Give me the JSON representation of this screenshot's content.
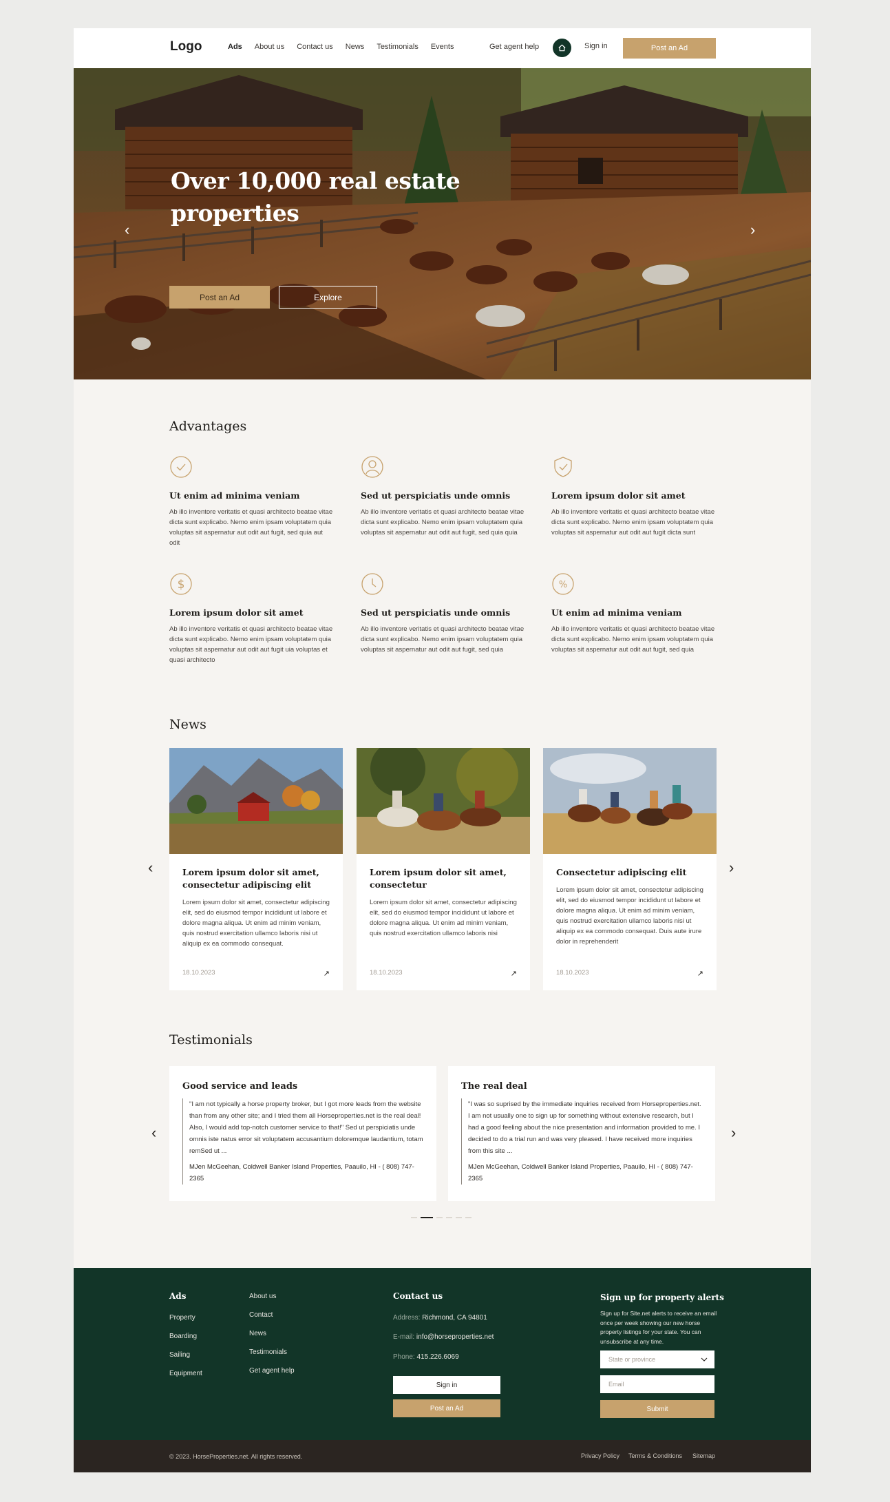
{
  "header": {
    "logo": "Logo",
    "nav": [
      "Ads",
      "About us",
      "Contact us",
      "News",
      "Testimonials",
      "Events"
    ],
    "agent_help": "Get agent help",
    "sign_in": "Sign in",
    "post_ad": "Post an Ad"
  },
  "hero": {
    "title": "Over 10,000  real estate properties",
    "post_ad": "Post an Ad",
    "explore": "Explore"
  },
  "advantages": {
    "heading": "Advantages",
    "items": [
      {
        "icon": "check-circle-icon",
        "title": "Ut enim ad minima veniam",
        "text": "Ab illo inventore veritatis et quasi architecto beatae vitae dicta sunt explicabo. Nemo enim ipsam voluptatem quia voluptas sit aspernatur aut odit aut fugit, sed quia  aut odit"
      },
      {
        "icon": "user-circle-icon",
        "title": "Sed ut perspiciatis unde omnis",
        "text": "Ab illo inventore veritatis et quasi architecto beatae vitae dicta sunt explicabo. Nemo enim ipsam voluptatem quia voluptas sit aspernatur aut odit aut fugit, sed quia quia"
      },
      {
        "icon": "shield-check-icon",
        "title": "Lorem ipsum dolor sit amet",
        "text": "Ab illo inventore veritatis et quasi architecto beatae vitae dicta sunt explicabo. Nemo enim ipsam voluptatem quia voluptas sit aspernatur aut odit aut fugit dicta sunt"
      },
      {
        "icon": "dollar-circle-icon",
        "title": "Lorem ipsum dolor sit amet",
        "text": "Ab illo inventore veritatis et quasi architecto beatae vitae dicta sunt explicabo. Nemo enim ipsam voluptatem quia voluptas sit aspernatur aut odit aut fugit uia voluptas et quasi architecto"
      },
      {
        "icon": "clock-circle-icon",
        "title": "Sed ut perspiciatis unde omnis",
        "text": "Ab illo inventore veritatis et quasi architecto beatae vitae dicta sunt explicabo. Nemo enim ipsam voluptatem quia voluptas sit aspernatur aut odit aut fugit, sed quia"
      },
      {
        "icon": "percent-circle-icon",
        "title": "Ut enim ad minima veniam",
        "text": "Ab illo inventore veritatis et quasi architecto beatae vitae dicta sunt explicabo. Nemo enim ipsam voluptatem quia voluptas sit aspernatur aut odit aut fugit, sed quia"
      }
    ]
  },
  "news": {
    "heading": "News",
    "items": [
      {
        "title": "Lorem ipsum dolor sit amet, consectetur adipiscing elit",
        "text": "Lorem ipsum dolor sit amet, consectetur adipiscing elit, sed do eiusmod tempor incididunt ut labore et dolore magna aliqua. Ut enim ad minim veniam, quis nostrud exercitation ullamco laboris nisi ut aliquip ex ea commodo consequat.",
        "date": "18.10.2023"
      },
      {
        "title": "Lorem ipsum dolor sit amet, consectetur",
        "text": "Lorem ipsum dolor sit amet, consectetur adipiscing elit, sed do eiusmod tempor incididunt ut labore et dolore magna aliqua. Ut enim ad minim veniam, quis nostrud exercitation ullamco laboris nisi",
        "date": "18.10.2023"
      },
      {
        "title": "Consectetur adipiscing elit",
        "text": "Lorem ipsum dolor sit amet, consectetur adipiscing elit, sed do eiusmod tempor incididunt ut labore et dolore magna aliqua. Ut enim ad minim veniam, quis nostrud exercitation ullamco laboris nisi ut aliquip ex ea commodo consequat. Duis aute irure dolor in reprehenderit",
        "date": "18.10.2023"
      }
    ]
  },
  "testimonials": {
    "heading": "Testimonials",
    "items": [
      {
        "title": "Good service and leads",
        "quote": "\"I am not typically a horse property broker, but I got more leads from the website than from any other site; and I tried them all Horseproperties.net is the real deal! Also, I would add top-notch customer service to that!\" Sed ut perspiciatis unde omnis iste natus error sit voluptatem accusantium doloremque laudantium, totam remSed ut ...",
        "author": "MJen McGeehan, Coldwell Banker Island Properties, Paauilo, HI - ( 808) 747-2365"
      },
      {
        "title": "The real deal",
        "quote": "\"I was so suprised by the immediate inquiries received from Horseproperties.net. I am not usually one to sign up for something without extensive research, but I had a good feeling about the nice presentation and information provided to me. I decided to do a trial run and was very pleased. I have received more inquiries from this site ...",
        "author": "MJen McGeehan, Coldwell Banker Island Properties, Paauilo, HI - ( 808) 747-2365"
      }
    ]
  },
  "footer": {
    "ads_heading": "Ads",
    "ads_links": [
      "Property",
      "Boarding",
      "Sailing",
      "Equipment"
    ],
    "more_links": [
      "About us",
      "Contact",
      "News",
      "Testimonials",
      "Get agent help"
    ],
    "contact_heading": "Contact us",
    "address_label": "Address:",
    "address": "Richmond, CA 94801",
    "email_label": "E-mail:",
    "email": "info@horseproperties.net",
    "phone_label": "Phone:",
    "phone": "415.226.6069",
    "sign_in": "Sign in",
    "post_ad": "Post an Ad",
    "signup_heading": "Sign up for property alerts",
    "signup_text": "Sign up for Site.net alerts to receive an email once per week showing our new horse property listings for your state. You can unsubscribe at any time.",
    "state_placeholder": "State or province",
    "email_placeholder": "Email",
    "submit": "Submit"
  },
  "bottom": {
    "copyright": "© 2023. HorseProperties.net. All rights reserved.",
    "links": [
      "Privacy Policy",
      "Terms & Conditions",
      "Sitemap"
    ]
  },
  "colors": {
    "accent": "#c7a26d",
    "dark_green": "#123528",
    "bottom_bar": "#2b2521"
  }
}
